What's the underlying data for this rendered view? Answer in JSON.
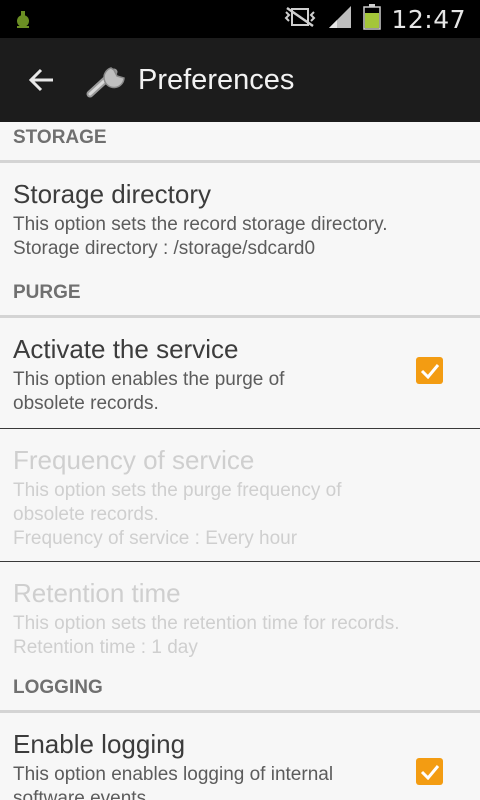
{
  "status_bar": {
    "time": "12:47",
    "icons": [
      "debug-icon",
      "mute-vibrate-icon",
      "signal-icon",
      "battery-icon"
    ],
    "battery_color": "#a4c639"
  },
  "action_bar": {
    "title": "Preferences",
    "back_icon": "arrow-left-icon",
    "app_icon": "wrench-icon"
  },
  "categories": {
    "storage": "STORAGE",
    "purge": "PURGE",
    "logging": "LOGGING"
  },
  "prefs": {
    "storage_directory": {
      "title": "Storage directory",
      "summary_1": "This option sets the record storage directory.",
      "summary_2": "Storage directory : /storage/sdcard0"
    },
    "activate_service": {
      "title": "Activate the service",
      "summary_1": "This option enables the purge of",
      "summary_2": "obsolete records.",
      "checked": true
    },
    "frequency": {
      "title": "Frequency of service",
      "summary_1": "This option sets the purge frequency of",
      "summary_2": "obsolete records.",
      "summary_3": "Frequency of service : Every hour",
      "enabled": false
    },
    "retention": {
      "title": "Retention time",
      "summary_1": "This option sets the retention time for records.",
      "summary_2": "Retention time : 1 day",
      "enabled": false
    },
    "enable_logging": {
      "title": "Enable logging",
      "summary_1": "This option enables logging of internal",
      "summary_2": "software events.",
      "checked": true
    }
  },
  "colors": {
    "accent_checkbox": "#f39c12",
    "action_bar": "#1c1c1c",
    "background": "#f7f7f7"
  }
}
